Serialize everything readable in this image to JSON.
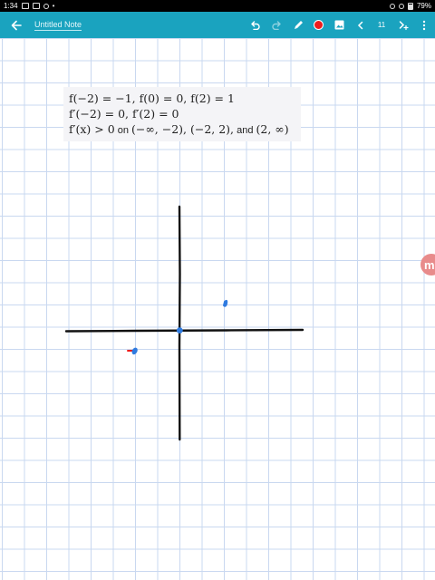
{
  "status_bar": {
    "time": "1:34",
    "battery": "79%"
  },
  "toolbar": {
    "note_title": "Untitled Note",
    "page_number": "11",
    "pen_color": "#ee1c1c",
    "background_color": "#1aa3bf",
    "icons": [
      "back-arrow-icon",
      "undo-icon",
      "redo-icon",
      "pen-icon",
      "color-dot",
      "image-icon",
      "chevron-left-icon",
      "next-page-icon",
      "more-vert-icon"
    ]
  },
  "math_box": {
    "line1": "f(−2) = −1, f(0) = 0, f(2) = 1",
    "line2": "f′(−2) = 0, f′(2) = 0",
    "line3_math1": "f′(x) > 0",
    "line3_text1": " on ",
    "line3_math2": "(−∞, −2), (−2, 2),",
    "line3_text2": " and ",
    "line3_math3": "(2, ∞)"
  },
  "side_badge": {
    "label": "m"
  },
  "colors": {
    "grid": "#c9d8f0",
    "axis": "#111111",
    "point": "#2f7be0",
    "marker": "#ee1c1c"
  }
}
